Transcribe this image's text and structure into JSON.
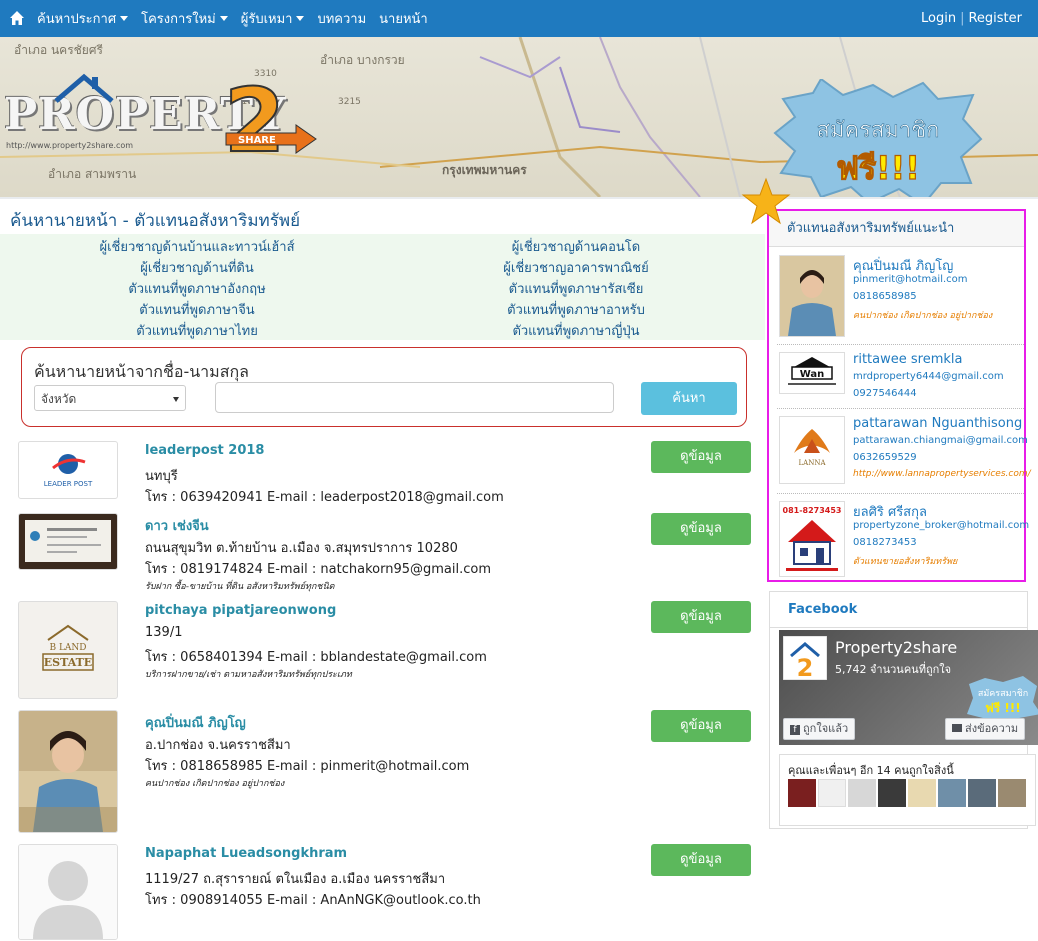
{
  "nav": {
    "menu": [
      {
        "label": "ค้นหาประกาศ",
        "caret": true
      },
      {
        "label": "โครงการใหม่",
        "caret": true
      },
      {
        "label": "ผู้รับเหมา",
        "caret": true
      },
      {
        "label": "บทความ",
        "caret": false
      },
      {
        "label": "นายหน้า",
        "caret": false
      }
    ],
    "login": "Login",
    "register": "Register"
  },
  "hero": {
    "map_labels": [
      "อำเภอ นครชัยศรี",
      "อำเภอ บางกรวย",
      "อำเภอ สามพราน",
      "กรุงเทพมหานคร",
      "3310",
      "3310",
      "3215"
    ],
    "logo_text": "PROPERTY",
    "logo_url": "http://www.property2share.com",
    "logo_badge": "SHARE",
    "signup_line1": "สมัครสมาชิก",
    "signup_line2": "ฟรี!!!"
  },
  "page_title": "ค้นหานายหน้า - ตัวแทนอสังหาริมทรัพย์",
  "categories": {
    "left": [
      "ผู้เชี่ยวชาญด้านบ้านและทาวน์เฮ้าส์",
      "ผู้เชี่ยวชาญด้านที่ดิน",
      "ตัวแทนที่พูดภาษาอังกฤษ",
      "ตัวแทนที่พูดภาษาจีน",
      "ตัวแทนที่พูดภาษาไทย"
    ],
    "right": [
      "ผู้เชี่ยวชาญด้านคอนโด",
      "ผู้เชี่ยวชาญอาคารพาณิชย์",
      "ตัวแทนที่พูดภาษารัสเซีย",
      "ตัวแทนที่พูดภาษาอาหรับ",
      "ตัวแทนที่พูดภาษาญี่ปุ่น"
    ]
  },
  "search": {
    "label": "ค้นหานายหน้าจากชื่อ-นามสกุล",
    "province_selected": "จังหวัด",
    "name_value": "",
    "button": "ค้นหา"
  },
  "agents": [
    {
      "name": "leaderpost 2018",
      "address": "นทบุรี",
      "contact": "โทร : 0639420941    E-mail : leaderpost2018@gmail.com",
      "note": "",
      "button": "ดูข้อมูล",
      "photo_text": "LEADER POST"
    },
    {
      "name": "ดาว เช่งจีน",
      "address": "ถนนสุขุมวิท ต.ท้ายบ้าน อ.เมือง จ.สมุทรปราการ 10280",
      "contact": "โทร : 0819174824    E-mail : natchakorn95@gmail.com",
      "note": "รับฝาก ซื้อ-ขายบ้าน ที่ดิน อสังหาริมทรัพย์ทุกชนิด",
      "button": "ดูข้อมูล",
      "photo_text": ""
    },
    {
      "name": "pitchaya pipatjareonwong",
      "address": "139/1",
      "contact": "โทร : 0658401394    E-mail : bblandestate@gmail.com",
      "note": "บริการฝากขาย/เช่า ตามหาอสังหาริมทรัพย์ทุกประเภท",
      "button": "ดูข้อมูล",
      "photo_text": "ESTATE"
    },
    {
      "name": "คุณปิ่นมณี ภิญโญ",
      "address": "อ.ปากช่อง จ.นครราชสีมา",
      "contact": "โทร : 0818658985    E-mail : pinmerit@hotmail.com",
      "note": "คนปากช่อง เกิดปากช่อง อยู่ปากช่อง",
      "button": "ดูข้อมูล",
      "photo_text": ""
    },
    {
      "name": "Napaphat Lueadsongkhram",
      "address": "1119/27 ถ.สุรารายณ์ ตในเมือง อ.เมือง นครราชสีมา",
      "contact": "โทร : 0908914055    E-mail : AnAnNGK@outlook.co.th",
      "note": "",
      "button": "ดูข้อมูล",
      "photo_text": ""
    }
  ],
  "recommended": {
    "title": "ตัวแทนอสังหาริมทรัพย์แนะนำ",
    "items": [
      {
        "name": "คุณปิ่นมณี ภิญโญ",
        "email": "pinmerit@hotmail.com",
        "tel": "0818658985",
        "note": "คนปากช่อง เกิดปากช่อง อยู่ปากช่อง",
        "photo_text": ""
      },
      {
        "name": "rittawee sremkla",
        "email": "mrdproperty6444@gmail.com",
        "tel": "0927546444",
        "note": "",
        "photo_text": "Wan"
      },
      {
        "name": "pattarawan Nguanthisong",
        "email": "pattarawan.chiangmai@gmail.com",
        "tel": "0632659529",
        "note": "http://www.lannapropertyservices.com/",
        "photo_text": "LANNA"
      },
      {
        "name": "ยลศิริ ศรีสกุล",
        "email": "propertyzone_broker@hotmail.com",
        "tel": "0818273453",
        "note": "ตัวแทนขายอสังหาริมทรัพย",
        "photo_text": "081-8273453"
      }
    ]
  },
  "facebook": {
    "title": "Facebook",
    "page_name": "Property2share",
    "likes": "5,742 จำนวนคนที่ถูกใจ",
    "liked_button": "ถูกใจแล้ว",
    "message_button": "ส่งข้อความ",
    "friends_text": "คุณและเพื่อนๆ อีก 14 คนถูกใจสิ่งนี้",
    "cover_text_1": "สมัครสมาชิก",
    "cover_text_2": "ฟรี !!!"
  },
  "colors": {
    "nav": "#1f7abf",
    "view_button": "#5cb85c",
    "search_button": "#5bc0de",
    "highlight_border": "#e81ce8"
  }
}
